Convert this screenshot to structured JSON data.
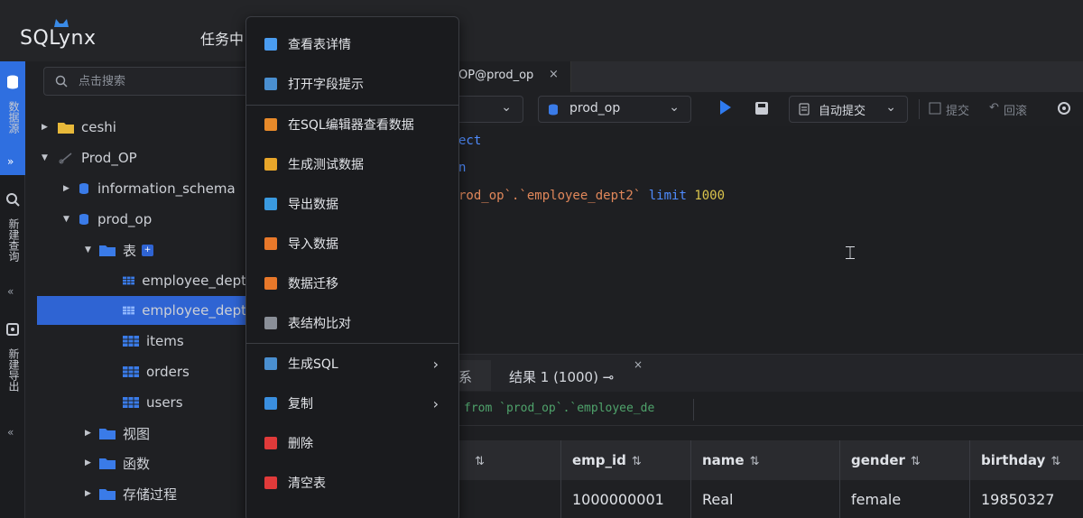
{
  "app": {
    "logo": "SQLynx",
    "top_menu": "任务中"
  },
  "strip": {
    "tab1": "数据源",
    "tab2": "新建查询",
    "tab3": "新建导出"
  },
  "sidebar": {
    "search_placeholder": "点击搜索",
    "tree": [
      {
        "label": "ceshi"
      },
      {
        "label": "Prod_OP"
      },
      {
        "label": "information_schema"
      },
      {
        "label": "prod_op"
      },
      {
        "label": "表"
      },
      {
        "label": "employee_dept"
      },
      {
        "label": "employee_dept"
      },
      {
        "label": "items"
      },
      {
        "label": "orders"
      },
      {
        "label": "users"
      },
      {
        "label": "视图"
      },
      {
        "label": "函数"
      },
      {
        "label": "存储过程"
      }
    ]
  },
  "editor_tab": {
    "label": "OP@prod_op",
    "close": "×"
  },
  "toolbar": {
    "database": "prod_op",
    "autocommit": "自动提交",
    "commit": "提交",
    "rollback": "回滚"
  },
  "editor": {
    "line1": "ect",
    "line3_str": "rod_op`.`employee_dept2`",
    "line3_kw": "limit",
    "line3_num": "1000"
  },
  "results": {
    "tab1": "系",
    "tab2": "结果 1 (1000)",
    "tab2_icon": "⊸",
    "close": "×",
    "sql": "from `prod_op`.`employee_de",
    "columns": [
      "emp_id",
      "name",
      "gender",
      "birthday"
    ],
    "rows": [
      [
        "1000000001",
        "Real",
        "female",
        "19850327"
      ]
    ]
  },
  "context_menu": {
    "items": [
      {
        "label": "查看表详情",
        "color": "#4a9cf0"
      },
      {
        "label": "打开字段提示",
        "color": "#4a8fd0"
      },
      {
        "label": "在SQL编辑器查看数据",
        "color": "#e88a2a"
      },
      {
        "label": "生成测试数据",
        "color": "#e8a62a"
      },
      {
        "label": "导出数据",
        "color": "#3a9ae0"
      },
      {
        "label": "导入数据",
        "color": "#e8782a"
      },
      {
        "label": "数据迁移",
        "color": "#e8782a"
      },
      {
        "label": "表结构比对",
        "color": "#8a8f98"
      },
      {
        "label": "生成SQL",
        "color": "#4a8fd0"
      },
      {
        "label": "复制",
        "color": "#3a8fe0"
      },
      {
        "label": "删除",
        "color": "#e03a3a"
      },
      {
        "label": "清空表",
        "color": "#e03a3a"
      }
    ]
  }
}
